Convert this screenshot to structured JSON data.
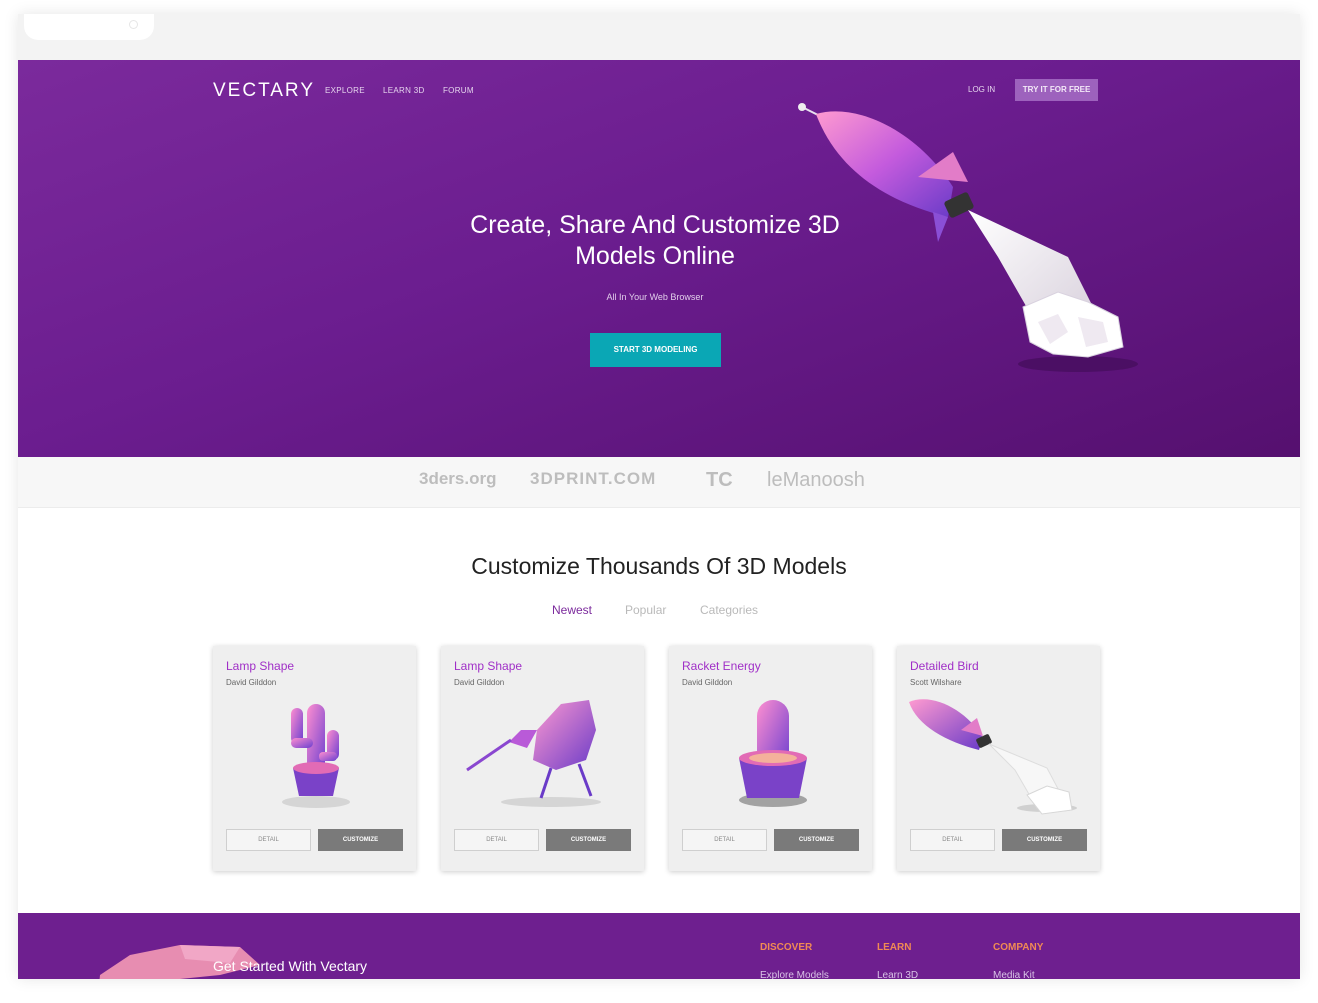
{
  "header": {
    "logo": "VECTARY",
    "nav": [
      "EXPLORE",
      "LEARN 3D",
      "FORUM"
    ],
    "login": "LOG IN",
    "try_free": "TRY IT FOR FREE"
  },
  "hero": {
    "title": "Create, Share And Customize 3D Models Online",
    "subtitle": "All In Your Web Browser",
    "cta": "START 3D MODELING"
  },
  "press": [
    "3ders.org",
    "3DPRINT.COM",
    "TC",
    "leManoosh"
  ],
  "models": {
    "title": "Customize Thousands Of 3D Models",
    "tabs": [
      "Newest",
      "Popular",
      "Categories"
    ],
    "detail_label": "DETAIL",
    "customize_label": "CUSTOMIZE",
    "cards": [
      {
        "title": "Lamp Shape",
        "author": "David Gilddon"
      },
      {
        "title": "Lamp Shape",
        "author": "David Gilddon"
      },
      {
        "title": "Racket Energy",
        "author": "David Gilddon"
      },
      {
        "title": "Detailed Bird",
        "author": "Scott Wilshare"
      }
    ]
  },
  "footer": {
    "cta": "Get Started With Vectary",
    "columns": [
      {
        "heading": "DISCOVER",
        "link": "Explore Models"
      },
      {
        "heading": "LEARN",
        "link": "Learn 3D"
      },
      {
        "heading": "COMPANY",
        "link": "Media Kit"
      }
    ]
  },
  "colors": {
    "hero_purple": "#6b1d8f",
    "cta_teal": "#0aa7b5",
    "card_title": "#a02fc7",
    "footer_heading": "#f08a54"
  }
}
